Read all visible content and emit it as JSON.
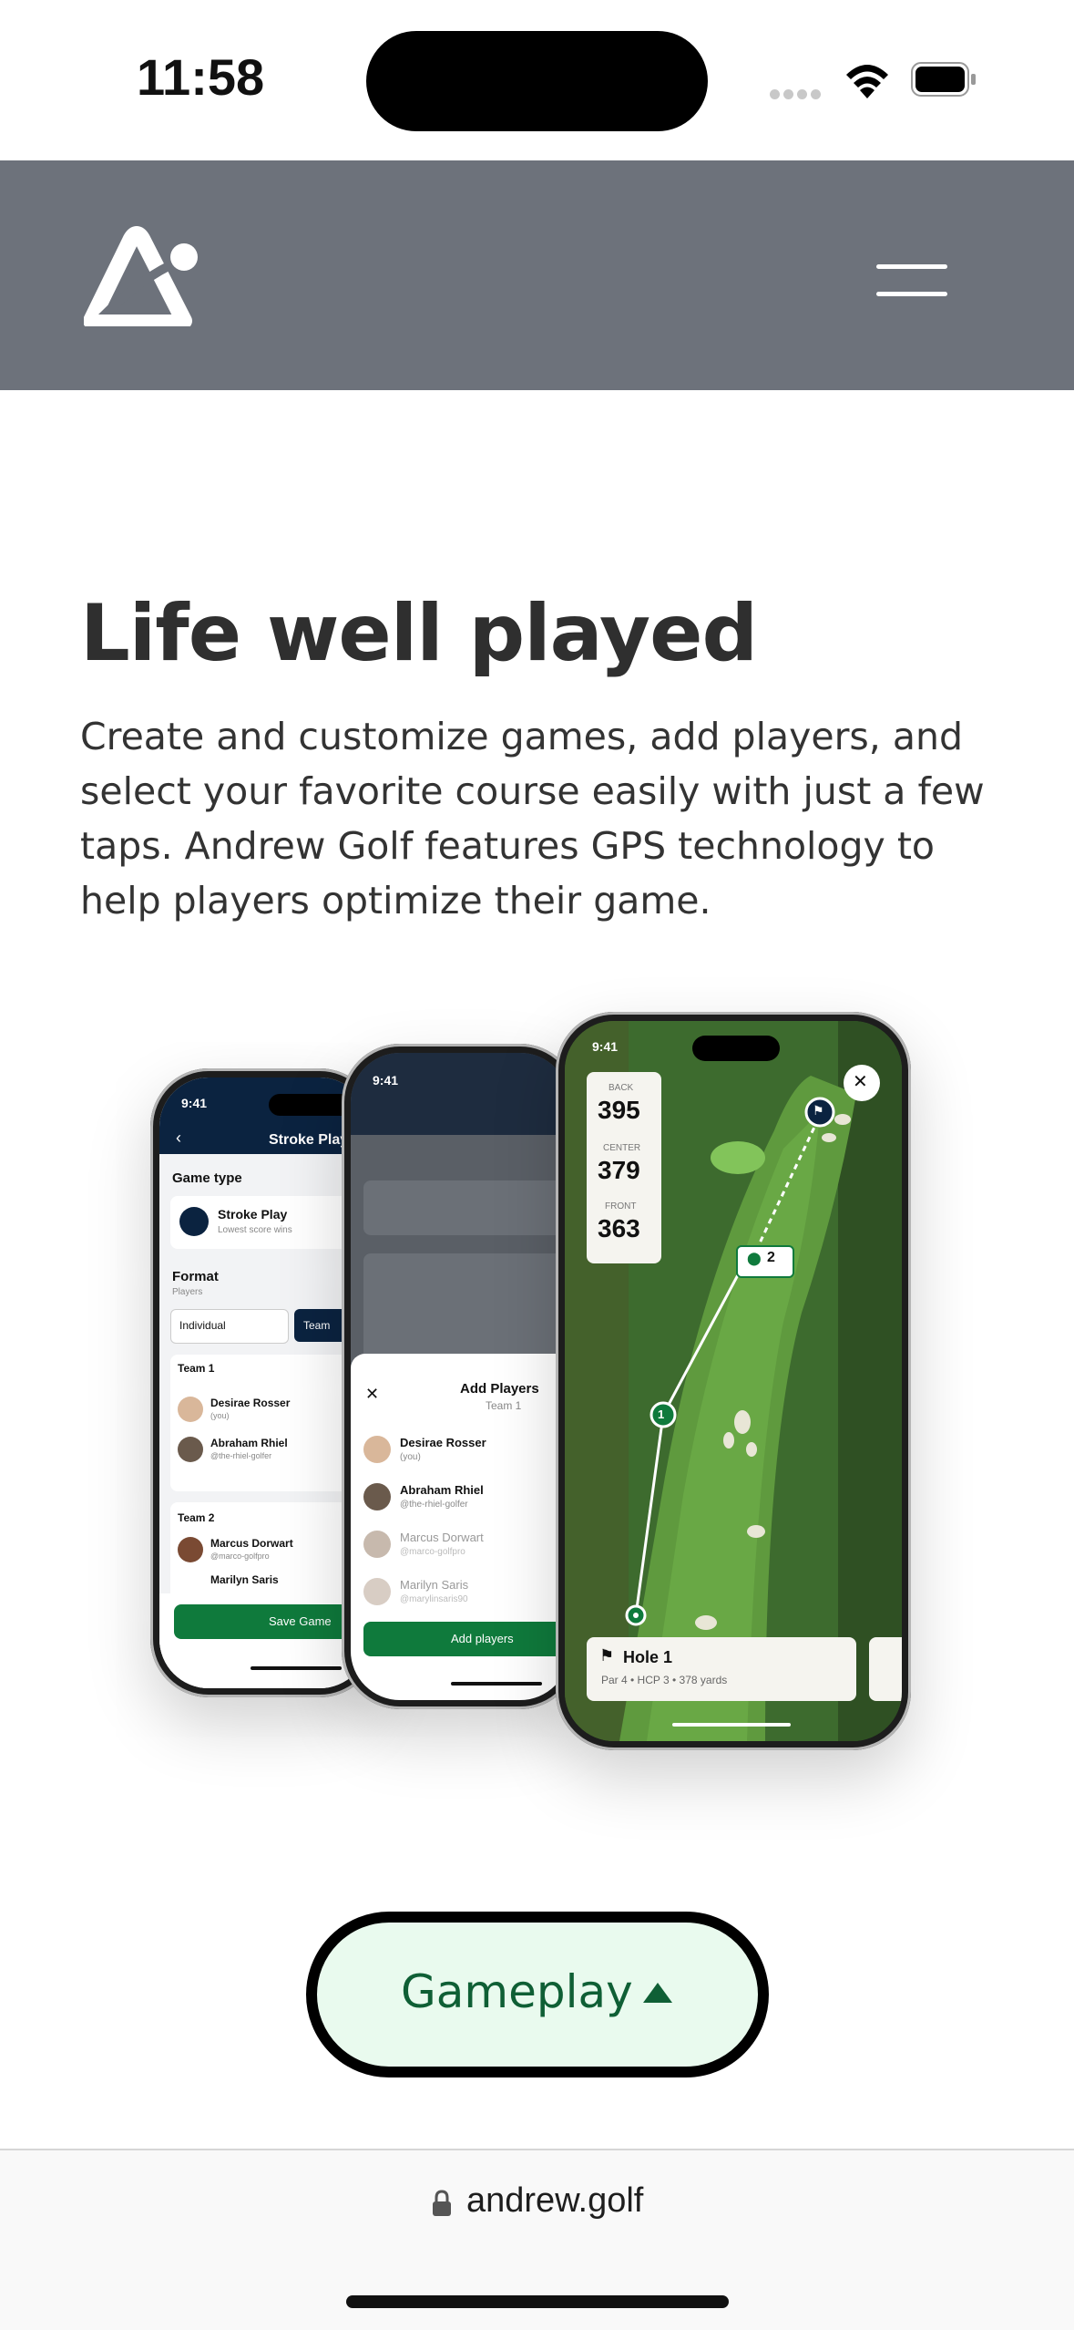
{
  "status_bar": {
    "time": "11:58"
  },
  "header": {
    "logo_icon": "andrew-golf-logo",
    "menu_icon": "hamburger-menu-icon"
  },
  "hero": {
    "headline": "Life well played",
    "body": "Create and customize games, add players, and select your favorite course easily with just a few taps. Andrew Golf features GPS technology to help players optimize their game."
  },
  "phone_left": {
    "time": "9:41",
    "title": "Stroke Play",
    "game_type_label": "Game type",
    "game_type_value": "Stroke Play",
    "game_type_sub": "Lowest score wins",
    "format_label": "Format",
    "format_sub": "Players",
    "option_individual": "Individual",
    "option_team": "Team",
    "team1": "Team 1",
    "team2": "Team 2",
    "players": [
      {
        "name": "Desirae Rosser",
        "handle": "(you)"
      },
      {
        "name": "Abraham Rhiel",
        "handle": "@the-rhiel-golfer"
      },
      {
        "name": "Marcus Dorwart",
        "handle": "@marco-golfpro"
      },
      {
        "name": "Marilyn Saris",
        "handle": ""
      }
    ],
    "save_button": "Save Game"
  },
  "phone_middle": {
    "time": "9:41",
    "sheet_title": "Add Players",
    "sheet_subtitle": "Team 1",
    "players": [
      {
        "name": "Desirae Rosser",
        "handle": "(you)"
      },
      {
        "name": "Abraham Rhiel",
        "handle": "@the-rhiel-golfer"
      },
      {
        "name": "Marcus Dorwart",
        "handle": "@marco-golfpro"
      },
      {
        "name": "Marilyn Saris",
        "handle": "@marylinsaris90"
      }
    ],
    "add_button": "Add players"
  },
  "phone_right": {
    "time": "9:41",
    "back_label": "BACK",
    "back_value": "395",
    "center_label": "CENTER",
    "center_value": "379",
    "front_label": "FRONT",
    "front_value": "363",
    "marker_1": "1",
    "marker_2": "2",
    "hole_title": "Hole 1",
    "hole_details": "Par 4  •  HCP 3  •  378 yards"
  },
  "cta": {
    "label": "Gameplay",
    "icon": "caret-up-icon"
  },
  "browser": {
    "url": "andrew.golf",
    "lock_icon": "lock-icon"
  },
  "colors": {
    "header_bg": "#6d727b",
    "brand_green": "#0f7a3c",
    "navy": "#0b2340",
    "cta_bg": "#e9faee"
  }
}
